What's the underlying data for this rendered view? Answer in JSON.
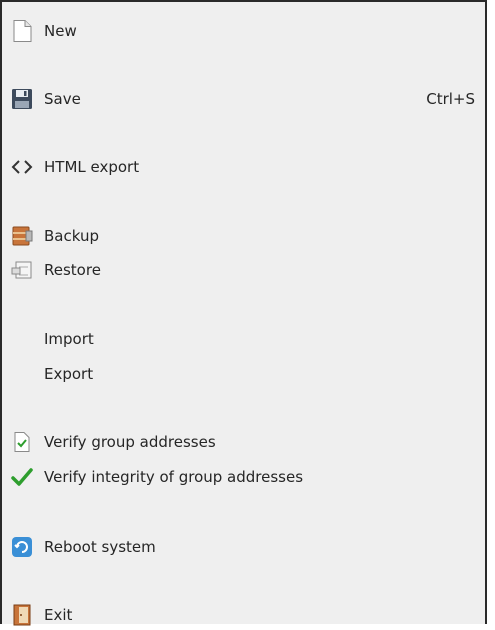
{
  "menu": {
    "items": [
      {
        "label": "New",
        "icon": "new-document-icon",
        "shortcut": ""
      },
      {
        "label": "Save",
        "icon": "floppy-disk-icon",
        "shortcut": "Ctrl+S"
      },
      {
        "label": "HTML export",
        "icon": "code-brackets-icon",
        "shortcut": ""
      },
      {
        "label": "Backup",
        "icon": "backup-archive-icon",
        "shortcut": ""
      },
      {
        "label": "Restore",
        "icon": "restore-icon",
        "shortcut": ""
      },
      {
        "label": "Import",
        "icon": "",
        "shortcut": ""
      },
      {
        "label": "Export",
        "icon": "",
        "shortcut": ""
      },
      {
        "label": "Verify group addresses",
        "icon": "verify-document-icon",
        "shortcut": ""
      },
      {
        "label": "Verify integrity of group addresses",
        "icon": "green-checkmark-icon",
        "shortcut": ""
      },
      {
        "label": "Reboot system",
        "icon": "reboot-icon",
        "shortcut": ""
      },
      {
        "label": "Exit",
        "icon": "exit-door-icon",
        "shortcut": ""
      }
    ]
  },
  "colors": {
    "background": "#efefef",
    "text": "#262626",
    "check": "#2e9e2e",
    "reboot": "#3a8fd6"
  }
}
